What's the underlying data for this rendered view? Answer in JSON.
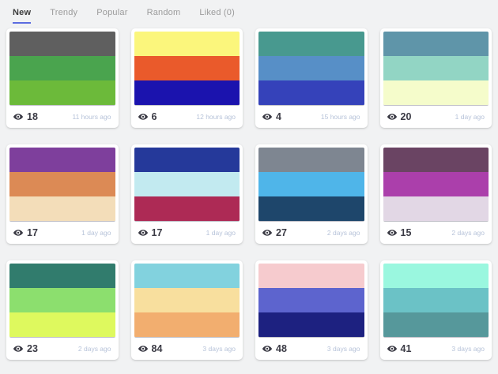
{
  "nav": {
    "tabs": [
      {
        "label": "New",
        "active": true
      },
      {
        "label": "Trendy",
        "active": false
      },
      {
        "label": "Popular",
        "active": false
      },
      {
        "label": "Random",
        "active": false
      },
      {
        "label": "Liked (0)",
        "active": false
      }
    ]
  },
  "palettes": [
    {
      "colors": [
        "#5f5f5f",
        "#4aa44e",
        "#6cba3a"
      ],
      "views": "18",
      "time": "11 hours ago"
    },
    {
      "colors": [
        "#fbf67c",
        "#ea5a2b",
        "#1b13ae"
      ],
      "views": "6",
      "time": "12 hours ago"
    },
    {
      "colors": [
        "#48998f",
        "#578fc7",
        "#3542ba"
      ],
      "views": "4",
      "time": "15 hours ago"
    },
    {
      "colors": [
        "#5f95a9",
        "#92d5c4",
        "#f5fccb"
      ],
      "views": "20",
      "time": "1 day ago"
    },
    {
      "colors": [
        "#7e3f9c",
        "#dc8a55",
        "#f3ddb9"
      ],
      "views": "17",
      "time": "1 day ago"
    },
    {
      "colors": [
        "#25399a",
        "#c2eaf0",
        "#ad2a55"
      ],
      "views": "17",
      "time": "1 day ago"
    },
    {
      "colors": [
        "#7e8691",
        "#4fb5e9",
        "#1e466b"
      ],
      "views": "27",
      "time": "2 days ago"
    },
    {
      "colors": [
        "#6a4463",
        "#ab3fab",
        "#e2d7e5"
      ],
      "views": "15",
      "time": "2 days ago"
    },
    {
      "colors": [
        "#317c6d",
        "#8cdf6e",
        "#def95e"
      ],
      "views": "23",
      "time": "2 days ago"
    },
    {
      "colors": [
        "#82d2de",
        "#f8df9e",
        "#f2ae6f"
      ],
      "views": "84",
      "time": "3 days ago"
    },
    {
      "colors": [
        "#f6cbce",
        "#5d64ce",
        "#1d2180"
      ],
      "views": "48",
      "time": "3 days ago"
    },
    {
      "colors": [
        "#9af7df",
        "#6bc2c6",
        "#56989b"
      ],
      "views": "41",
      "time": "3 days ago"
    }
  ],
  "theme": {
    "bg": "#f1f2f3",
    "card_bg": "#ffffff",
    "accent": "#5b6ce0",
    "tab_color": "#9b9b9b",
    "tab_active_color": "#3c3c3c",
    "count_color": "#3a3a44",
    "time_color": "#b7c3d9"
  }
}
